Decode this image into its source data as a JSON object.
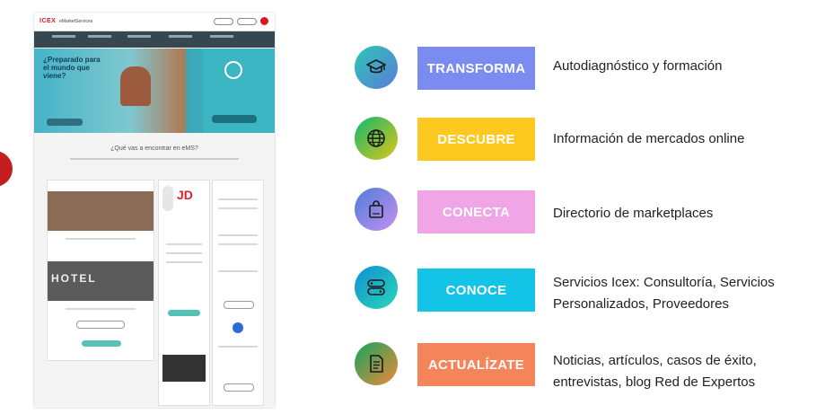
{
  "screenshot": {
    "logo_text": "ICEX",
    "brand_text": "eMarketServices",
    "hero_title": "¿Preparado para el mundo que viene?",
    "question_text": "¿Qué vas a encontrar en eMS?",
    "hotel_text": "HOTEL",
    "jd_logo_text": "JD"
  },
  "rows": [
    {
      "icon": "graduation-cap-icon",
      "label": "TRANSFORMA",
      "desc": "Autodiagnóstico y formación",
      "color": "#7b8cf1",
      "icon_grad": [
        "#2cc7b6",
        "#5b7bd9"
      ]
    },
    {
      "icon": "globe-icon",
      "label": "DESCUBRE",
      "desc": "Información de mercados online",
      "color": "#fdc820",
      "icon_grad": [
        "#0fb96b",
        "#e0c51b"
      ]
    },
    {
      "icon": "shopping-bag-icon",
      "label": "CONECTA",
      "desc": "Directorio de marketplaces",
      "color": "#f0a6e6",
      "icon_grad": [
        "#4d7fd9",
        "#c78ef0"
      ]
    },
    {
      "icon": "link-icon",
      "label": "CONOCE",
      "desc_lines": [
        "Servicios Icex: Consultoría, Servicios",
        "Personalizados, Proveedores"
      ],
      "color": "#14c4e6",
      "icon_grad": [
        "#0f8fd1",
        "#2bd7b9"
      ]
    },
    {
      "icon": "document-icon",
      "label": "ACTUALÍZATE",
      "desc_lines": [
        "Noticias,  artículos, casos de éxito,",
        "entrevistas, blog Red de Expertos"
      ],
      "color": "#f4845a",
      "icon_grad": [
        "#12a55f",
        "#f08a3a"
      ]
    }
  ]
}
